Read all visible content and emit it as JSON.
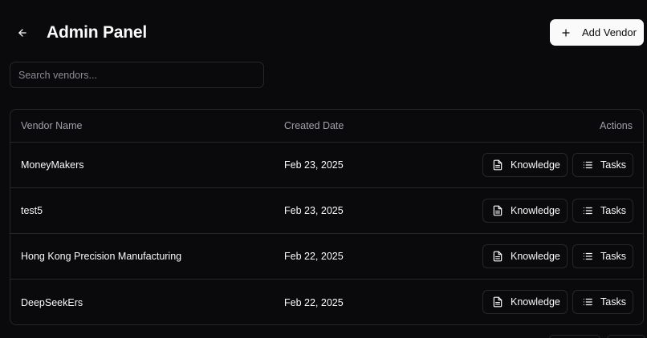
{
  "header": {
    "title": "Admin Panel",
    "back_icon": "arrow-left-icon",
    "add_button_label": "Add Vendor",
    "add_icon": "plus-icon"
  },
  "search": {
    "placeholder": "Search vendors...",
    "value": ""
  },
  "table": {
    "columns": [
      "Vendor Name",
      "Created Date",
      "Actions"
    ],
    "rows": [
      {
        "name": "MoneyMakers",
        "created": "Feb 23, 2025"
      },
      {
        "name": "test5",
        "created": "Feb 23, 2025"
      },
      {
        "name": "Hong Kong Precision Manufacturing",
        "created": "Feb 22, 2025"
      },
      {
        "name": "DeepSeekErs",
        "created": "Feb 22, 2025"
      }
    ],
    "actions": {
      "knowledge_label": "Knowledge",
      "knowledge_icon": "file-text-icon",
      "tasks_label": "Tasks",
      "tasks_icon": "list-icon"
    }
  },
  "colors": {
    "background": "#0a0a0c",
    "border": "#27272a",
    "text": "#fafafa",
    "muted": "#a1a1aa",
    "primary_button": "#fafafa"
  }
}
